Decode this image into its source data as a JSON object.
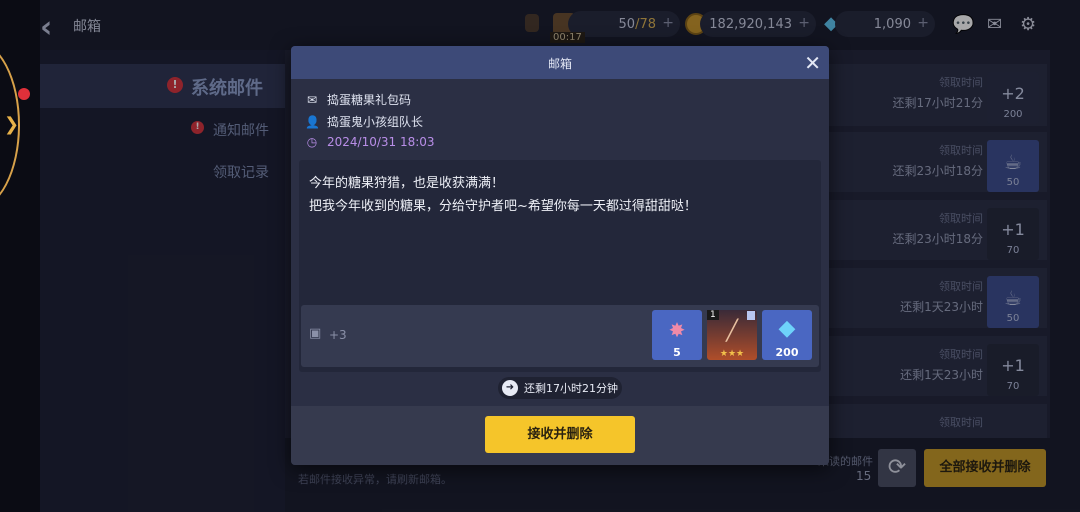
{
  "topbar": {
    "title": "邮箱",
    "stamina": {
      "current": "50",
      "max": "/78",
      "timer": "00:17"
    },
    "gold": "182,920,143",
    "gems": "1,090",
    "plus": "+"
  },
  "sidebar": {
    "system_mail": "系统邮件",
    "notify_mail": "通知邮件",
    "claim_record": "领取记录",
    "alert": "!"
  },
  "mail_list": {
    "time_label": "领取时间",
    "rows": [
      {
        "time": "还剩17小时21分",
        "thumb": "+2",
        "qty": "200"
      },
      {
        "time": "还剩23小时18分",
        "thumb": "☕",
        "qty": "50"
      },
      {
        "time": "还剩23小时18分",
        "thumb": "+1",
        "qty": "70"
      },
      {
        "time": "还剩1天23小时",
        "thumb": "☕",
        "qty": "50"
      },
      {
        "time": "还剩1天23小时",
        "thumb": "+1",
        "qty": "70"
      }
    ]
  },
  "footer": {
    "note": "若邮件接收异常，请刷新邮箱。",
    "unread_label": "未读的邮件",
    "unread_count": "15",
    "refresh_icon": "⟳",
    "claim_all": "全部接收并删除"
  },
  "dialog": {
    "title": "邮箱",
    "close": "✕",
    "subject": "捣蛋糖果礼包码",
    "sender": "捣蛋鬼小孩组队长",
    "date": "2024/10/31 18:03",
    "body_line1": "今年的糖果狩猎，也是收获满满！",
    "body_line2": "把我今年收到的糖果，分给守护者吧~希望你每一天都过得甜甜哒！",
    "gift_extra": "+3",
    "rewards": [
      {
        "icon": "candy-badge-icon",
        "qty": "5"
      },
      {
        "icon": "magic-wand-icon",
        "qty": "★★★",
        "corner": "1"
      },
      {
        "icon": "diamond-icon",
        "qty": "200"
      }
    ],
    "remaining": "还剩17小时21分钟",
    "accept_button": "接收并删除"
  },
  "colors": {
    "accent_yellow": "#f5c52a",
    "header_blue": "#3d4a78",
    "date_purple": "#b98ee8"
  }
}
